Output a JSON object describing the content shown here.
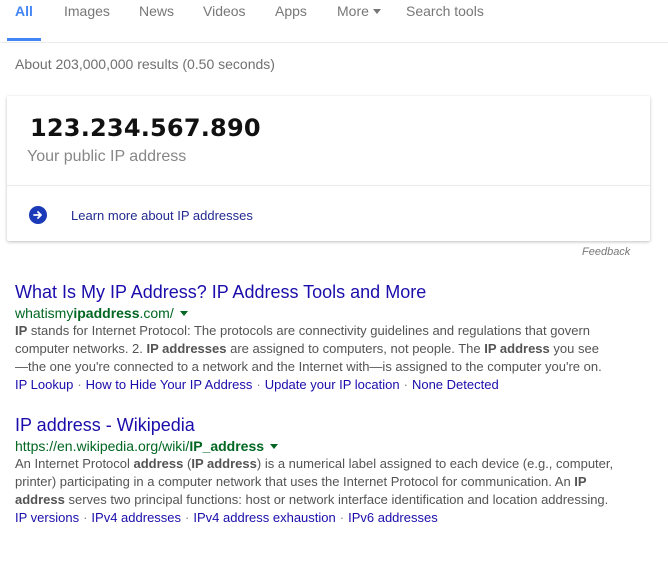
{
  "tabs": [
    {
      "label": "All",
      "active": true
    },
    {
      "label": "Images"
    },
    {
      "label": "News"
    },
    {
      "label": "Videos"
    },
    {
      "label": "Apps"
    },
    {
      "label": "More"
    },
    {
      "label": "Search tools"
    }
  ],
  "stats": "About 203,000,000 results (0.50 seconds)",
  "ip_card": {
    "value": "123.234.567.890",
    "caption": "Your public IP address",
    "learn_more": "Learn more about IP addresses",
    "icon": "arrow-right-circle-icon",
    "icon_color": "#1a3ab8"
  },
  "feedback": "Feedback",
  "results": [
    {
      "title": "What Is My IP Address? IP Address Tools and More",
      "url_pre": "whatismy",
      "url_bold": "ipaddress",
      "url_post": ".com/",
      "snippet": [
        {
          "t": "IP",
          "b": true
        },
        {
          "t": " stands for Internet Protocol: The protocols are connectivity guidelines and regulations that govern computer networks. 2. "
        },
        {
          "t": "IP addresses",
          "b": true
        },
        {
          "t": " are assigned to computers, not people. The "
        },
        {
          "t": "IP address",
          "b": true
        },
        {
          "t": " you see —the one you're connected to a network and the Internet with—is assigned to the computer you're on."
        }
      ],
      "links": [
        "IP Lookup",
        "How to Hide Your IP Address",
        "Update your IP location",
        "None Detected"
      ]
    },
    {
      "title": "IP address - Wikipedia",
      "url_pre": "https://en.wikipedia.org/wiki/",
      "url_bold": "IP_address",
      "url_post": "",
      "snippet": [
        {
          "t": "An Internet Protocol "
        },
        {
          "t": "address",
          "b": true
        },
        {
          "t": " ("
        },
        {
          "t": "IP address",
          "b": true
        },
        {
          "t": ") is a numerical label assigned to each device (e.g., computer, printer) participating in a computer network that uses the Internet Protocol for communication. An "
        },
        {
          "t": "IP address",
          "b": true
        },
        {
          "t": " serves two principal functions: host or network interface identification and location addressing."
        }
      ],
      "links": [
        "IP versions",
        "IPv4 addresses",
        "IPv4 address exhaustion",
        "IPv6 addresses"
      ]
    }
  ],
  "colors": {
    "accent": "#4285f4",
    "title_link": "#1a0dab",
    "url_green": "#006621",
    "snippet": "#545454"
  }
}
